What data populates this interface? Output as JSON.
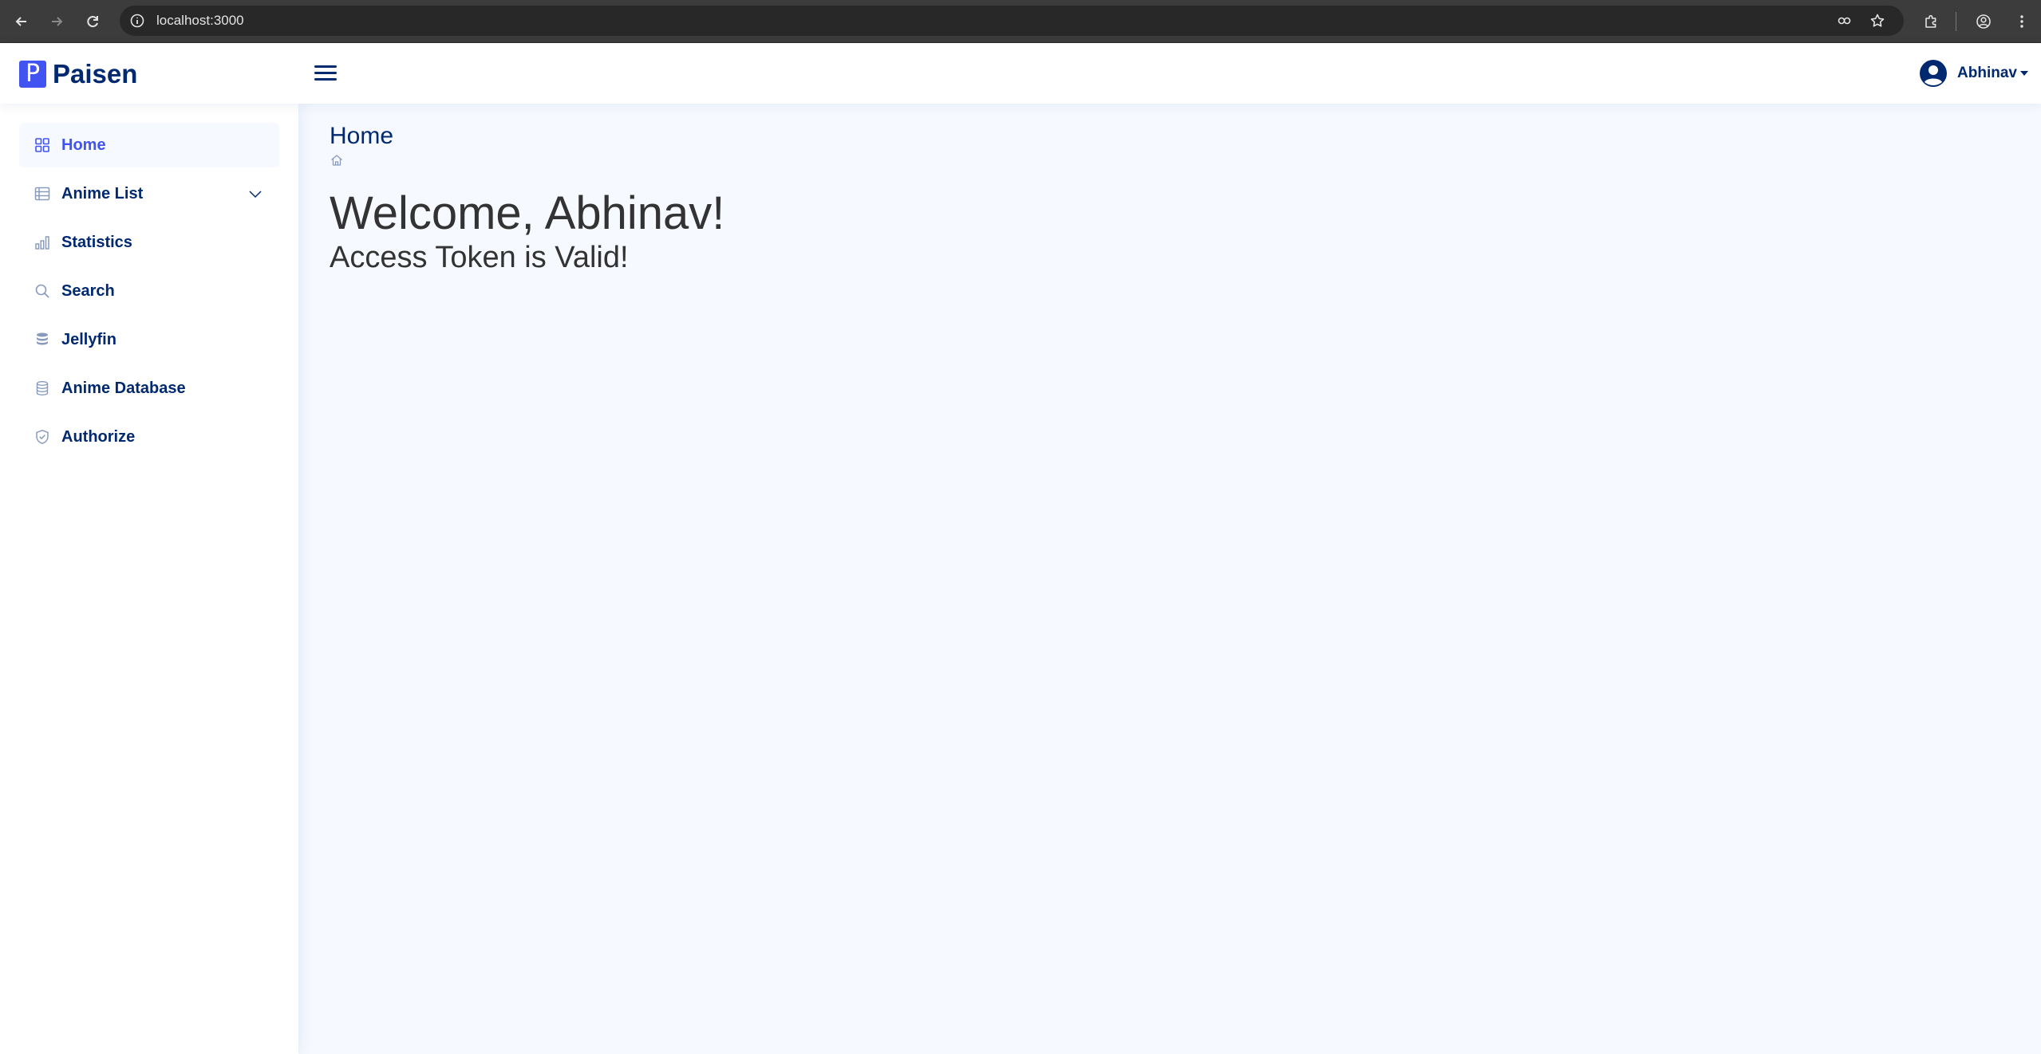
{
  "browser": {
    "url": "localhost:3000"
  },
  "header": {
    "logo_letter": "P",
    "brand": "Paisen",
    "user_name": "Abhinav"
  },
  "sidebar": {
    "items": [
      {
        "label": "Home",
        "icon": "grid-icon",
        "active": true
      },
      {
        "label": "Anime List",
        "icon": "list-icon",
        "expandable": true
      },
      {
        "label": "Statistics",
        "icon": "bar-chart-icon"
      },
      {
        "label": "Search",
        "icon": "search-icon"
      },
      {
        "label": "Jellyfin",
        "icon": "database-filled-icon"
      },
      {
        "label": "Anime Database",
        "icon": "database-icon"
      },
      {
        "label": "Authorize",
        "icon": "shield-check-icon"
      }
    ]
  },
  "main": {
    "page_title": "Home",
    "breadcrumb_icon": "house-icon",
    "welcome": "Welcome, Abhinav!",
    "status": "Access Token is Valid!"
  },
  "colors": {
    "brand": "#4154f1",
    "navy": "#012970",
    "background": "#f6f9ff"
  }
}
